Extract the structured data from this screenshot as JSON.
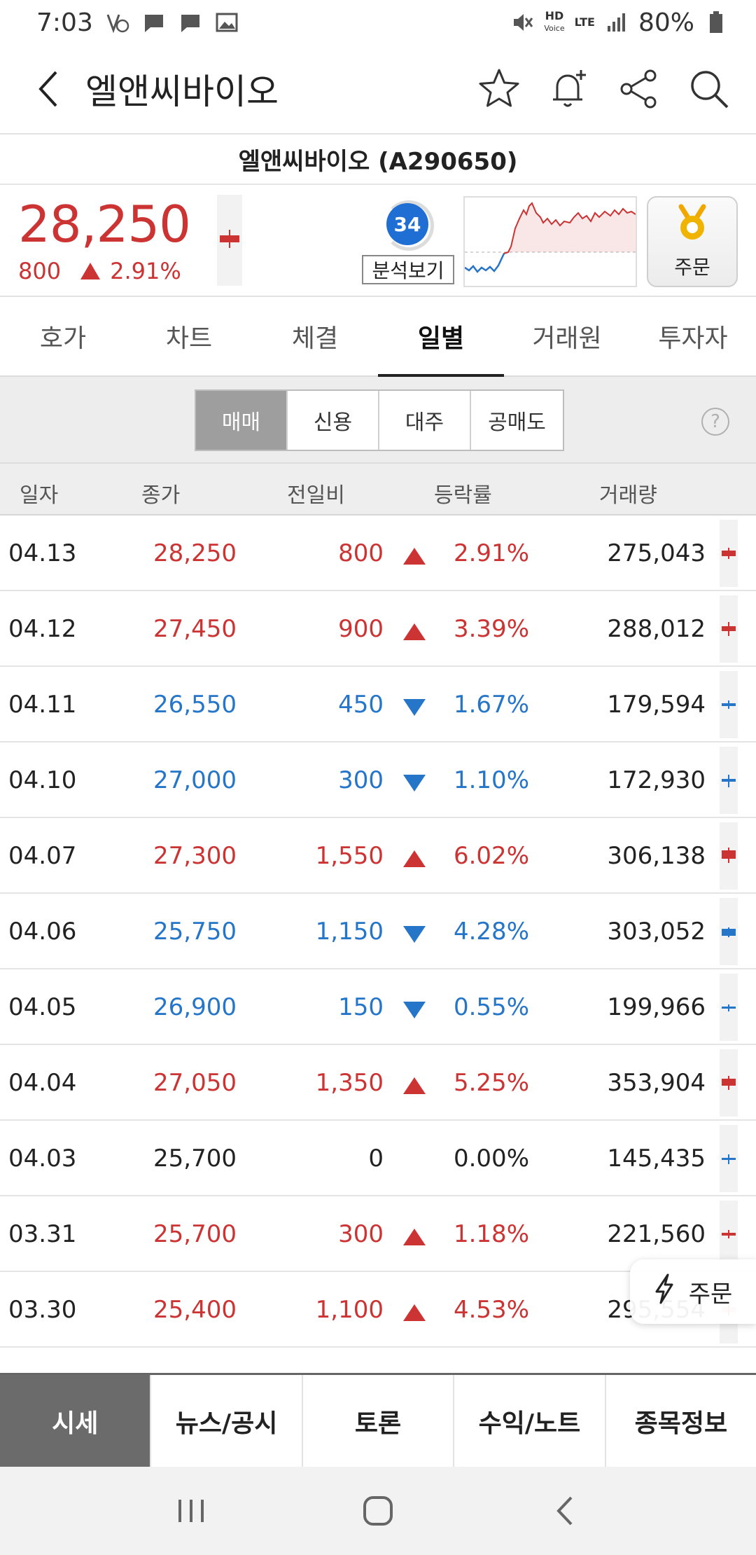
{
  "status": {
    "time": "7:03",
    "lte": "LTE",
    "hd": "HD",
    "voice": "Voice",
    "battery": "80%"
  },
  "header": {
    "title": "엘앤씨바이오"
  },
  "stock": {
    "full_name": "엘앤씨바이오 (A290650)",
    "price": "28,250",
    "change": "800",
    "change_rate": "2.91%",
    "score": "34",
    "analysis_label": "분석보기",
    "order_label": "주문"
  },
  "tabs": [
    {
      "label": "호가"
    },
    {
      "label": "차트"
    },
    {
      "label": "체결"
    },
    {
      "label": "일별"
    },
    {
      "label": "거래원"
    },
    {
      "label": "투자자"
    }
  ],
  "segments": [
    {
      "label": "매매"
    },
    {
      "label": "신용"
    },
    {
      "label": "대주"
    },
    {
      "label": "공매도"
    }
  ],
  "help_label": "?",
  "table": {
    "headers": [
      "일자",
      "종가",
      "전일비",
      "등락률",
      "거래량"
    ],
    "rows": [
      {
        "date": "04.13",
        "close": "28,250",
        "diff": "800",
        "dir": "up",
        "rate": "2.91%",
        "volume": "275,043"
      },
      {
        "date": "04.12",
        "close": "27,450",
        "diff": "900",
        "dir": "up",
        "rate": "3.39%",
        "volume": "288,012"
      },
      {
        "date": "04.11",
        "close": "26,550",
        "diff": "450",
        "dir": "down",
        "rate": "1.67%",
        "volume": "179,594"
      },
      {
        "date": "04.10",
        "close": "27,000",
        "diff": "300",
        "dir": "down",
        "rate": "1.10%",
        "volume": "172,930"
      },
      {
        "date": "04.07",
        "close": "27,300",
        "diff": "1,550",
        "dir": "up",
        "rate": "6.02%",
        "volume": "306,138"
      },
      {
        "date": "04.06",
        "close": "25,750",
        "diff": "1,150",
        "dir": "down",
        "rate": "4.28%",
        "volume": "303,052"
      },
      {
        "date": "04.05",
        "close": "26,900",
        "diff": "150",
        "dir": "down",
        "rate": "0.55%",
        "volume": "199,966"
      },
      {
        "date": "04.04",
        "close": "27,050",
        "diff": "1,350",
        "dir": "up",
        "rate": "5.25%",
        "volume": "353,904"
      },
      {
        "date": "04.03",
        "close": "25,700",
        "diff": "0",
        "dir": "flat",
        "rate": "0.00%",
        "volume": "145,435"
      },
      {
        "date": "03.31",
        "close": "25,700",
        "diff": "300",
        "dir": "up",
        "rate": "1.18%",
        "volume": "221,560"
      },
      {
        "date": "03.30",
        "close": "25,400",
        "diff": "1,100",
        "dir": "up",
        "rate": "4.53%",
        "volume": "295,554"
      }
    ]
  },
  "float_order_label": "주문",
  "bottom_nav": [
    {
      "label": "시세"
    },
    {
      "label": "뉴스/공시"
    },
    {
      "label": "토론"
    },
    {
      "label": "수익/노트"
    },
    {
      "label": "종목정보"
    }
  ],
  "colors": {
    "up": "#cc3333",
    "down": "#2575c9",
    "flat": "#222222",
    "accent_blue": "#1e6ed4"
  }
}
